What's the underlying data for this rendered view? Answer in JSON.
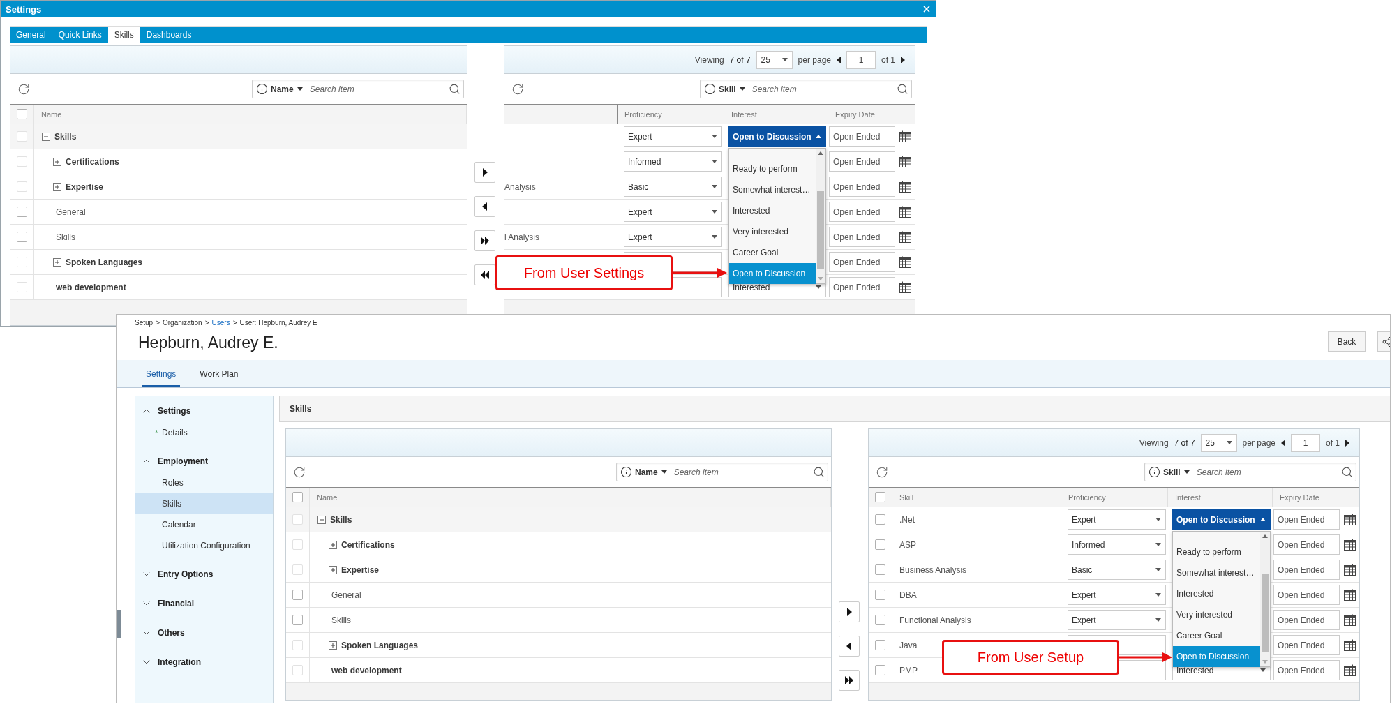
{
  "settings_dialog": {
    "title": "Settings",
    "tabs": [
      {
        "label": "General",
        "selected": false
      },
      {
        "label": "Quick Links",
        "selected": false
      },
      {
        "label": "Skills",
        "selected": true
      },
      {
        "label": "Dashboards",
        "selected": false
      }
    ],
    "skills_picker": {
      "available": {
        "search": {
          "field": "Name",
          "placeholder": "Search item"
        },
        "select_all": {
          "checked": false
        },
        "columns": [
          "Name"
        ],
        "tree": [
          {
            "label": "Skills",
            "kind": "category",
            "checked": false,
            "disabled": true,
            "expanded": true,
            "children": [
              {
                "label": "Certifications",
                "kind": "category",
                "checked": false,
                "disabled": true,
                "expanded": false
              },
              {
                "label": "Expertise",
                "kind": "category",
                "checked": false,
                "disabled": true,
                "expanded": false
              },
              {
                "label": "General",
                "kind": "item",
                "checked": false,
                "disabled": false
              },
              {
                "label": "Skills",
                "kind": "item",
                "checked": false,
                "disabled": false
              },
              {
                "label": "Spoken Languages",
                "kind": "category",
                "checked": false,
                "disabled": true,
                "expanded": false
              },
              {
                "label": "web development",
                "kind": "category",
                "checked": false,
                "disabled": true
              }
            ]
          }
        ]
      },
      "transfer_buttons": [
        {
          "kind": "add"
        },
        {
          "kind": "remove"
        },
        {
          "kind": "add_all"
        },
        {
          "kind": "remove_all"
        }
      ],
      "assigned": {
        "pager": {
          "viewing": "Viewing",
          "count": "7 of 7",
          "page_size": "25",
          "per_page": "per page",
          "page": "1",
          "page_count": "of 1"
        },
        "search": {
          "field": "Skill",
          "placeholder": "Search item"
        },
        "columns": [
          "Proficiency",
          "Interest",
          "Expiry Date"
        ],
        "rows": [
          {
            "proficiency": "Expert",
            "interest": "Open to Discussion",
            "expanded": true,
            "expiry": "Open Ended",
            "menu": [
              {
                "label": "Ready to perform",
                "selected": false
              },
              {
                "label": "Somewhat interest…",
                "selected": false
              },
              {
                "label": "Interested",
                "selected": false
              },
              {
                "label": "Very interested",
                "selected": false
              },
              {
                "label": "Career Goal",
                "selected": false
              },
              {
                "label": "Open to Discussion",
                "selected": true
              }
            ]
          },
          {
            "proficiency": "Informed",
            "expiry": "Open Ended"
          },
          {
            "skill": "Analysis",
            "proficiency": "Basic",
            "expiry": "Open Ended"
          },
          {
            "proficiency": "Expert",
            "expiry": "Open Ended"
          },
          {
            "skill": "l Analysis",
            "proficiency": "Expert",
            "expiry": "Open Ended"
          },
          {
            "expiry": "Open Ended"
          },
          {
            "interest": "Interested",
            "expanded": false,
            "expiry": "Open Ended"
          }
        ]
      }
    }
  },
  "user_setup": {
    "breadcrumb": [
      {
        "label": "Setup",
        "kind": "text"
      },
      {
        "label": ">",
        "kind": "separator"
      },
      {
        "label": "Organization",
        "kind": "text"
      },
      {
        "label": ">",
        "kind": "separator"
      },
      {
        "label": "Users",
        "kind": "link"
      },
      {
        "label": ">",
        "kind": "separator"
      },
      {
        "label": "User: Hepburn, Audrey E",
        "kind": "text"
      }
    ],
    "title": "Hepburn, Audrey E.",
    "back_button": "Back",
    "tabs": [
      {
        "label": "Settings",
        "selected": true
      },
      {
        "label": "Work Plan",
        "selected": false
      }
    ],
    "sidebar": [
      {
        "label": "Settings",
        "expanded": true,
        "items": [
          {
            "label": "Details",
            "marker": "*",
            "selected": false
          }
        ]
      },
      {
        "label": "Employment",
        "expanded": true,
        "items": [
          {
            "label": "Roles",
            "selected": false
          },
          {
            "label": "Skills",
            "selected": true
          },
          {
            "label": "Calendar",
            "selected": false
          },
          {
            "label": "Utilization Configuration",
            "selected": false
          }
        ]
      },
      {
        "label": "Entry Options",
        "expanded": false
      },
      {
        "label": "Financial",
        "expanded": false
      },
      {
        "label": "Others",
        "expanded": false
      },
      {
        "label": "Integration",
        "expanded": false
      }
    ],
    "section_title": "Skills",
    "skills_picker": {
      "available": {
        "search": {
          "field": "Name",
          "placeholder": "Search item"
        },
        "select_all": {
          "checked": false
        },
        "columns": [
          "Name"
        ],
        "tree": [
          {
            "label": "Skills",
            "kind": "category",
            "checked": false,
            "disabled": true,
            "expanded": true,
            "children": [
              {
                "label": "Certifications",
                "kind": "category",
                "checked": false,
                "disabled": true,
                "expanded": false
              },
              {
                "label": "Expertise",
                "kind": "category",
                "checked": false,
                "disabled": true,
                "expanded": false
              },
              {
                "label": "General",
                "kind": "item",
                "checked": false,
                "disabled": false
              },
              {
                "label": "Skills",
                "kind": "item",
                "checked": false,
                "disabled": false
              },
              {
                "label": "Spoken Languages",
                "kind": "category",
                "checked": false,
                "disabled": true,
                "expanded": false
              },
              {
                "label": "web development",
                "kind": "category",
                "checked": false,
                "disabled": true
              }
            ]
          }
        ]
      },
      "transfer_buttons": [
        {
          "kind": "add"
        },
        {
          "kind": "remove"
        },
        {
          "kind": "add_all"
        }
      ],
      "assigned": {
        "pager": {
          "viewing": "Viewing",
          "count": "7 of 7",
          "page_size": "25",
          "per_page": "per page",
          "page": "1",
          "page_count": "of 1"
        },
        "search": {
          "field": "Skill",
          "placeholder": "Search item"
        },
        "select_all": {
          "checked": false
        },
        "columns": [
          "Skill",
          "Proficiency",
          "Interest",
          "Expiry Date"
        ],
        "rows": [
          {
            "skill": ".Net",
            "checked": false,
            "proficiency": "Expert",
            "interest": "Open to Discussion",
            "expanded": true,
            "expiry": "Open Ended",
            "menu": [
              {
                "label": "Ready to perform",
                "selected": false
              },
              {
                "label": "Somewhat interest…",
                "selected": false
              },
              {
                "label": "Interested",
                "selected": false
              },
              {
                "label": "Very interested",
                "selected": false
              },
              {
                "label": "Career Goal",
                "selected": false
              },
              {
                "label": "Open to Discussion",
                "selected": true
              }
            ]
          },
          {
            "skill": "ASP",
            "checked": false,
            "proficiency": "Informed",
            "expiry": "Open Ended"
          },
          {
            "skill": "Business Analysis",
            "checked": false,
            "proficiency": "Basic",
            "expiry": "Open Ended"
          },
          {
            "skill": "DBA",
            "checked": false,
            "proficiency": "Expert",
            "expiry": "Open Ended"
          },
          {
            "skill": "Functional Analysis",
            "checked": false,
            "proficiency": "Expert",
            "expiry": "Open Ended"
          },
          {
            "skill": "Java",
            "checked": false,
            "expiry": "Open Ended"
          },
          {
            "skill": "PMP",
            "checked": false,
            "interest": "Interested",
            "expanded": false,
            "expiry": "Open Ended"
          }
        ]
      }
    }
  },
  "callouts": [
    {
      "text": "From User Settings"
    },
    {
      "text": "From User Setup"
    }
  ]
}
